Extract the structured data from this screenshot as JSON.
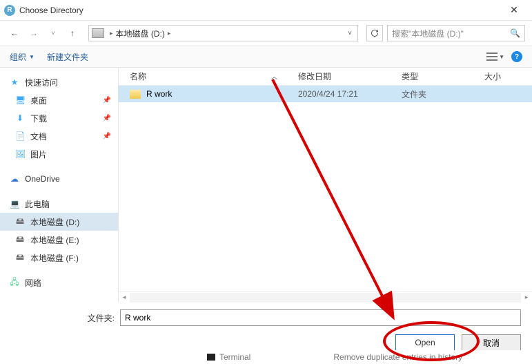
{
  "window": {
    "title": "Choose Directory"
  },
  "breadcrumb": {
    "location": "本地磁盘 (D:)"
  },
  "search": {
    "placeholder": "搜索\"本地磁盘 (D:)\""
  },
  "toolbar": {
    "organize": "组织",
    "newfolder": "新建文件夹"
  },
  "columns": {
    "name": "名称",
    "date": "修改日期",
    "type": "类型",
    "size": "大小"
  },
  "sidebar": {
    "quickaccess": "快速访问",
    "desktop": "桌面",
    "downloads": "下载",
    "documents": "文档",
    "pictures": "图片",
    "onedrive": "OneDrive",
    "thispc": "此电脑",
    "disk_d": "本地磁盘 (D:)",
    "disk_e": "本地磁盘 (E:)",
    "disk_f": "本地磁盘 (F:)",
    "network": "网络"
  },
  "files": [
    {
      "name": "R work",
      "date": "2020/4/24 17:21",
      "type": "文件夹"
    }
  ],
  "footer": {
    "label": "文件夹:",
    "value": "R work",
    "open": "Open",
    "cancel": "取消"
  },
  "trim": {
    "terminal": "Terminal",
    "dup": "Remove duplicate entries in history"
  }
}
